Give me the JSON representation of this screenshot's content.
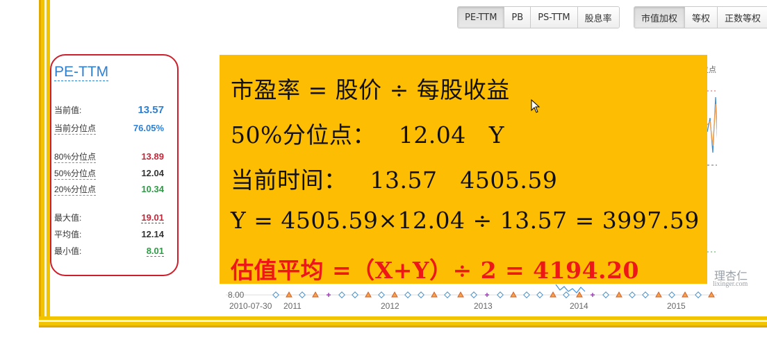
{
  "toolbar": {
    "metric_tabs": [
      "PE-TTM",
      "PB",
      "PS-TTM",
      "股息率"
    ],
    "weight_tabs": [
      "市值加权",
      "等权",
      "正数等权"
    ],
    "active_metric": "PE-TTM",
    "active_weight": "市值加权"
  },
  "stats": {
    "title": "PE-TTM",
    "current_label": "当前值:",
    "current_value": "13.57",
    "current_pct_label": "当前分位点",
    "current_pct_value": "76.05%",
    "p80_label": "80%分位点",
    "p80_value": "13.89",
    "p50_label": "50%分位点",
    "p50_value": "12.04",
    "p20_label": "20%分位点",
    "p20_value": "10.34",
    "max_label": "最大值:",
    "max_value": "19.01",
    "avg_label": "平均值:",
    "avg_value": "12.14",
    "min_label": "最小值:",
    "min_value": "8.01"
  },
  "chart": {
    "legend": "50%分位点",
    "y_min_label": "8.00",
    "x_labels": [
      "2010-07-30",
      "2011",
      "2012",
      "2013",
      "2014",
      "2015"
    ],
    "watermark_cn": "理杏仁",
    "watermark_en": "lixinger.com",
    "colors": {
      "line_blue": "#3f8fd8",
      "line_orange": "#f5a04a",
      "grid_red": "#e05050",
      "grid_green": "#44aa55",
      "grid_dark": "#666666"
    }
  },
  "overlay": {
    "line1": "市盈率 = 股价 ÷ 每股收益",
    "line2": "50%分位点：   12.04   Y",
    "line3": "当前时间：   13.57   4505.59",
    "line4": "Y = 4505.59×12.04 ÷ 13.57 = 3997.59",
    "line5": "估值平均 =（X+Y）÷ 2 = 4194.20",
    "background": "#fcbd03",
    "highlight_color": "#ee1616"
  }
}
